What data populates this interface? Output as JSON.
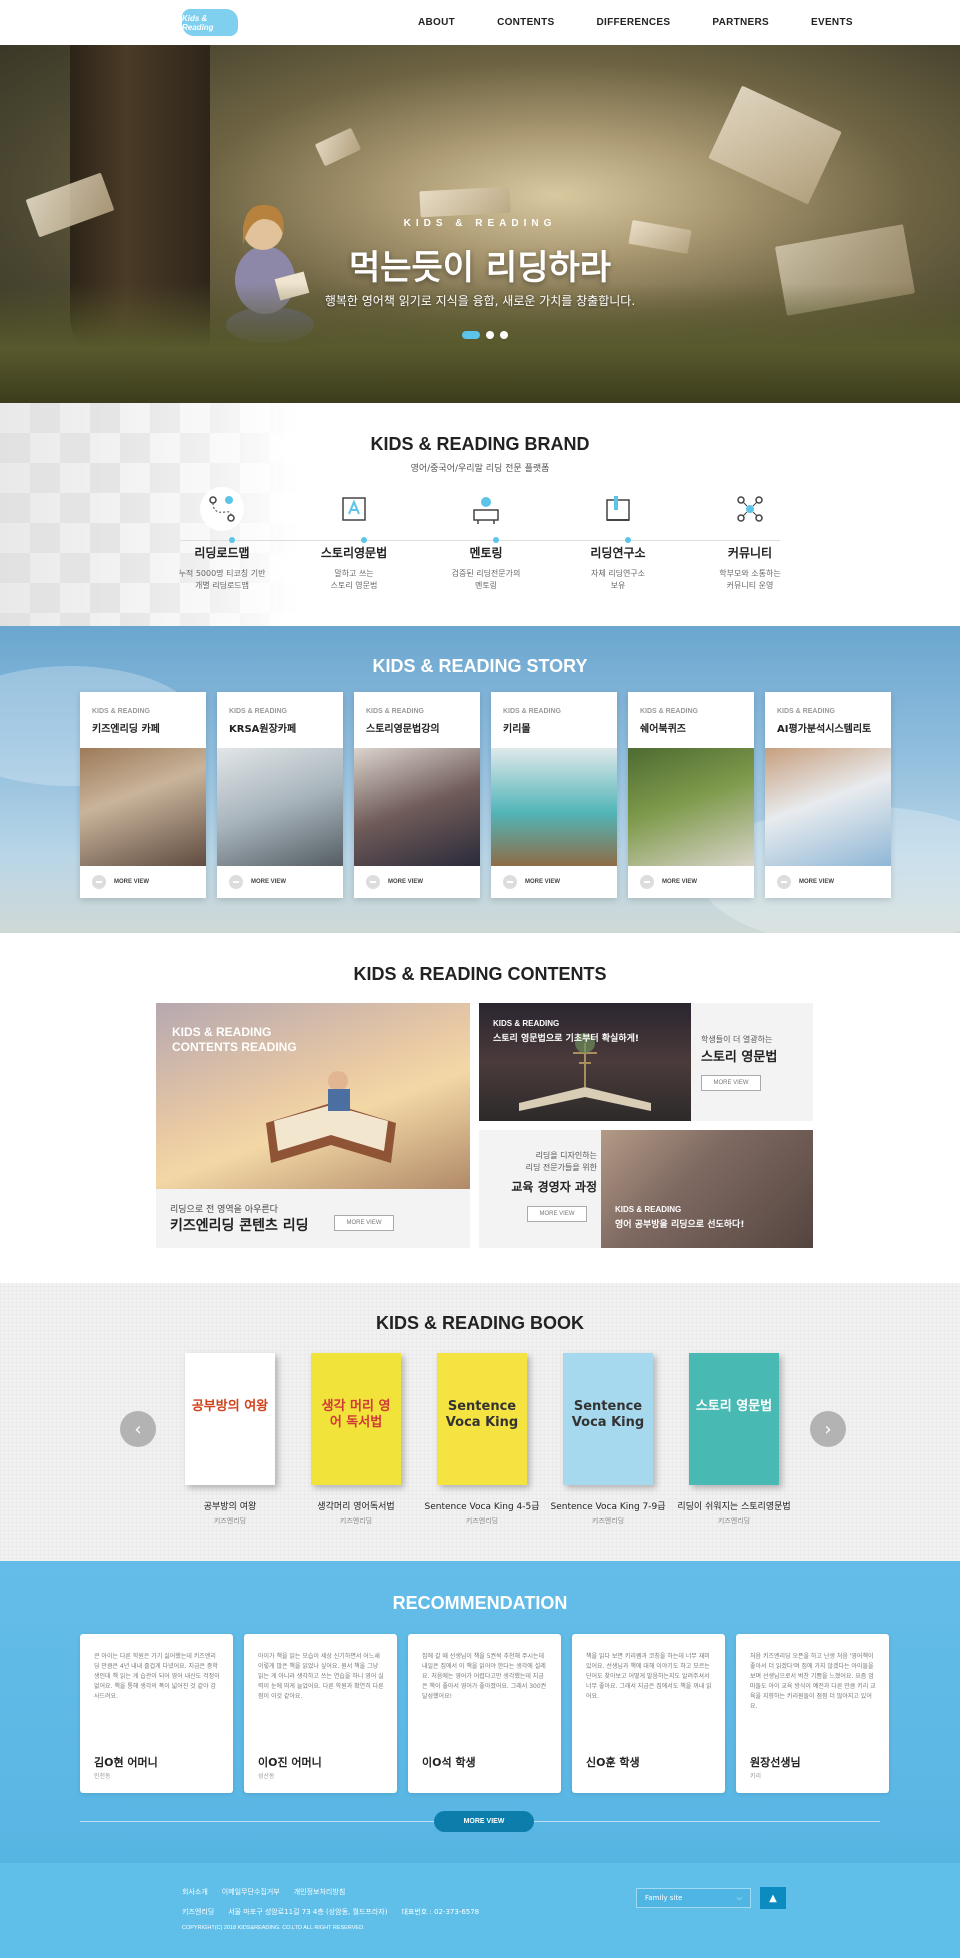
{
  "header": {
    "logo_text": "Kids & Reading",
    "nav": [
      "ABOUT",
      "CONTENTS",
      "DIFFERENCES",
      "PARTNERS",
      "EVENTS"
    ]
  },
  "hero": {
    "kicker": "KIDS & READING",
    "title": "먹는듯이 리딩하라",
    "subtitle": "행복한 영어책 읽기로 지식을 융합, 새로운 가치를 창출합니다.",
    "slides": 3,
    "active_slide": 1
  },
  "brand": {
    "title": "KIDS & READING BRAND",
    "subtitle": "영어/중국어/우리말 리딩 전문 플랫폼",
    "items": [
      {
        "icon": "roadmap-icon",
        "name": "리딩로드맵",
        "desc1": "누적 5000명 티코칭 기반",
        "desc2": "개별 리딩로드맵"
      },
      {
        "icon": "grammar-book-icon",
        "name": "스토리영문법",
        "desc1": "말하고 쓰는",
        "desc2": "스토리 영문법"
      },
      {
        "icon": "mentor-icon",
        "name": "멘토링",
        "desc1": "검증된 리딩전문가의",
        "desc2": "멘토링"
      },
      {
        "icon": "research-icon",
        "name": "리딩연구소",
        "desc1": "자체 리딩연구소",
        "desc2": "보유"
      },
      {
        "icon": "community-icon",
        "name": "커뮤니티",
        "desc1": "학부모와 소통하는",
        "desc2": "커뮤니티 운영"
      }
    ]
  },
  "story": {
    "title": "KIDS & READING STORY",
    "kicker": "KIDS & READING",
    "more_label": "MORE VIEW",
    "cards": [
      "키즈엔리딩 카페",
      "KRSA원장카페",
      "스토리영문법강의",
      "키리몰",
      "쉐어북퀴즈",
      "AI평가분석시스템리토"
    ]
  },
  "contents": {
    "title": "KIDS & READING CONTENTS",
    "more_label": "MORE VIEW",
    "big": {
      "kicker1": "KIDS & READING",
      "kicker2": "CONTENTS READING",
      "sub": "리딩으로 전 영역을 아우른다",
      "title": "키즈엔리딩 콘텐츠 리딩"
    },
    "card2": {
      "kicker": "KIDS & READING",
      "caption": "스토리 영문법으로 기초부터 확실하게!",
      "sub": "학생들이 더 열광하는",
      "title": "스토리 영문법"
    },
    "card3": {
      "sub1": "리딩을 디자인하는",
      "sub2": "리딩 전문가들을 위한",
      "title": "교육 경영자 과정",
      "kicker": "KIDS & READING",
      "caption": "영어 공부방을 리딩으로 선도하다!"
    }
  },
  "books": {
    "title": "KIDS & READING BOOK",
    "publisher": "키즈엔리딩",
    "items": [
      {
        "name": "공부방의 여왕",
        "cover_text": "공부방의 여왕",
        "cover_color": "#ffffff",
        "text_color": "#d0421b"
      },
      {
        "name": "생각머리 영어독서법",
        "cover_text": "생각 머리 영어 독서법",
        "cover_color": "#f2e33a",
        "text_color": "#d2373a"
      },
      {
        "name": "Sentence Voca King 4-5급",
        "cover_text": "Sentence Voca King",
        "cover_color": "#f4e340",
        "text_color": "#333333"
      },
      {
        "name": "Sentence Voca King 7-9급",
        "cover_text": "Sentence Voca King",
        "cover_color": "#a6d8ee",
        "text_color": "#333333"
      },
      {
        "name": "리딩이 쉬워지는 스토리영문법",
        "cover_text": "스토리 영문법",
        "cover_color": "#49b9b3",
        "text_color": "#ffffff"
      }
    ]
  },
  "recommendation": {
    "title": "RECOMMENDATION",
    "more_label": "MORE VIEW",
    "cards": [
      {
        "text": "큰 아이는 다른 학원은 가기 싫어했는데 키즈엔리딩 만큼은 4년 내내 즐겁게 다녔어요. 지금은 중학생인데 책 읽는 게 습관이 되어 영어 내신도 걱정이 없어요. 책을 통해 생각의 폭이 넓어진 것 같아 감사드려요.",
        "name": "김O현 어머니",
        "school": "인천동"
      },
      {
        "text": "아이가 책을 읽는 모습이 세상 신기하면서 어느새 이렇게 많은 책을 읽었나 싶어요. 원서 책을 그냥 읽는 게 아니라 생각하고 쓰는 연습을 하니 영어 실력이 눈에 띄게 늘었어요. 다른 학원과 확연히 다른 점이 이것 같아요.",
        "name": "이O진 어머니",
        "school": "성산동"
      },
      {
        "text": "집에 갈 때 선생님이 책을 5권씩 추천해 주시는데 내일은 집에서 이 책을 읽어야 한다는 생각에 설레요. 처음에는 영어가 어렵다고만 생각했는데 지금은 책이 좋아서 영어가 좋아졌어요. 그래서 300권 달성했어요!",
        "name": "이O석 학생",
        "school": ""
      },
      {
        "text": "책을 읽다 보면 키리쌤과 코칭을 하는데 너무 재미있어요. 선생님과 책에 대해 이야기도 하고 모르는 단어도 찾아보고 어떻게 발음하는지도 알려주셔서 너무 좋아요. 그래서 지금은 집에서도 책을 꺼내 읽어요.",
        "name": "신O훈 학생",
        "school": ""
      },
      {
        "text": "처음 키즈엔리딩 오픈을 하고 난생 처음 '영어책이 좋아서 더 읽겠다'며 집에 가지 않겠다는 아이들을 보며 선생님으로서 벅찬 기쁨을 느꼈어요. 요즘 엄마들도 아이 교육 방식이 예전과 다른 만큼 키리 교육을 지향하는 키리원들이 점점 더 많아지고 있어요.",
        "name": "원장선생님",
        "school": "키리"
      }
    ]
  },
  "footer": {
    "links": [
      "회사소개",
      "이메일무단수집거부",
      "개인정보처리방침"
    ],
    "company": "키즈엔리딩",
    "address": "서울 마포구 성암로11길 73 4층 (상암동, 월드프라자)",
    "phone": "대표번호 : 02-373-6578",
    "copyright": "COPYRIGHT(C) 2018 KIDS&READING. CO.LTD ALL RIGHT RESERVED.",
    "family_site": "Family site",
    "top_label": "▲"
  },
  "colors": {
    "accent": "#5bc4e8",
    "story_bg": "#8fbddd",
    "reco_bg": "#5cbae6",
    "footer_bg": "#5fbfe9",
    "button_dark": "#0d7dab"
  }
}
